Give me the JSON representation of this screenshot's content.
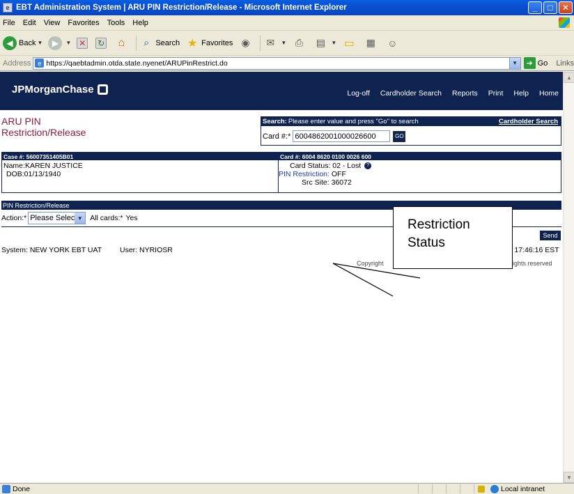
{
  "window": {
    "title": "EBT Administration System | ARU PIN Restriction/Release - Microsoft Internet Explorer",
    "app_icon": "e"
  },
  "menu": [
    "File",
    "Edit",
    "View",
    "Favorites",
    "Tools",
    "Help"
  ],
  "toolbar": {
    "back_label": "Back",
    "search_label": "Search",
    "favorites_label": "Favorites"
  },
  "address": {
    "label": "Address",
    "url": "https://qaebtadmin.otda.state.nyenet/ARUPinRestrict.do",
    "go_label": "Go",
    "links_label": "Links"
  },
  "header": {
    "brand": "JPMorganChase",
    "nav": [
      "Log-off",
      "Cardholder Search",
      "Reports",
      "Print",
      "Help",
      "Home"
    ]
  },
  "page": {
    "title_line1": "ARU PIN",
    "title_line2": "Restriction/Release"
  },
  "search": {
    "header_bold": "Search:",
    "header_text": "Please enter value and press \"Go\" to search",
    "cardholder_link": "Cardholder Search",
    "card_label": "Card #:*",
    "card_value": "6004862001000026600",
    "go_button": "GO"
  },
  "case": {
    "case_label": "Case #: 56007351405B01",
    "card_label": "Card #: 6004 8620 0100 0026 600",
    "name_label": "Name:",
    "name_value": "KAREN JUSTICE",
    "dob_label": "DOB:",
    "dob_value": "01/13/1940",
    "card_status_label": "Card Status:",
    "card_status_value": "02 - Lost",
    "pin_restriction_label": "PIN Restriction:",
    "pin_restriction_value": "OFF",
    "src_label": "Src Site:",
    "src_value": "36072"
  },
  "pin": {
    "section_label": "PIN Restriction/Release",
    "action_label": "Action:*",
    "action_value": "Please Select",
    "all_cards_label": "All cards:*",
    "all_cards_value": "Yes",
    "send_button": "Send"
  },
  "footer": {
    "system": "System: NEW YORK  EBT UAT",
    "user": "User: NYRIOSR",
    "time": "me: 17:46:16 EST",
    "copyright": "Copyright",
    "rights": "rights reserved"
  },
  "callout": {
    "line1": "Restriction",
    "line2": "Status"
  },
  "status": {
    "text": "Done",
    "zone": "Local intranet"
  },
  "colors": {
    "brand_navy": "#0f2350",
    "title_maroon": "#8a1c3c"
  }
}
